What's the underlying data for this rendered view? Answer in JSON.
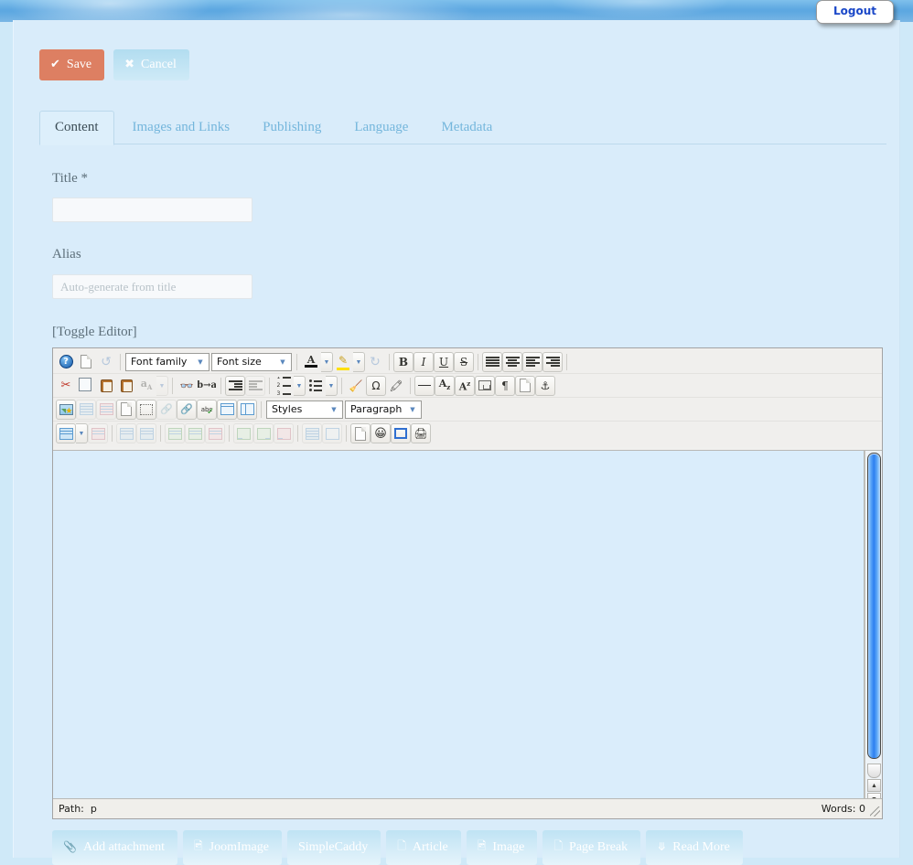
{
  "header": {
    "logout_label": "Logout"
  },
  "toolbar": {
    "save_label": "Save",
    "save_icon": "check-icon",
    "cancel_label": "Cancel",
    "cancel_icon": "close-circle-icon"
  },
  "tabs": [
    {
      "label": "Content",
      "active": true
    },
    {
      "label": "Images and Links",
      "active": false
    },
    {
      "label": "Publishing",
      "active": false
    },
    {
      "label": "Language",
      "active": false
    },
    {
      "label": "Metadata",
      "active": false
    }
  ],
  "form": {
    "title_label": "Title *",
    "title_value": "",
    "title_placeholder": "",
    "alias_label": "Alias",
    "alias_value": "",
    "alias_placeholder": "Auto-generate from title",
    "toggle_editor_label": "[Toggle Editor]"
  },
  "editor": {
    "selects": {
      "font_family": "Font family",
      "font_size": "Font size",
      "styles": "Styles",
      "paragraph": "Paragraph"
    },
    "status": {
      "path_label": "Path:",
      "path_value": "p",
      "words_label": "Words: 0"
    },
    "row1_icons": [
      "help-icon",
      "new-document-icon",
      "undo-icon",
      "text-color-icon",
      "background-color-icon",
      "redo-icon",
      "bold-icon",
      "italic-icon",
      "underline-icon",
      "strikethrough-icon",
      "align-justify-icon",
      "align-center-icon",
      "align-left-icon",
      "align-right-icon"
    ],
    "row2_icons": [
      "cut-icon",
      "copy-icon",
      "paste-icon",
      "paste-text-icon",
      "remove-format-icon",
      "find-icon",
      "find-replace-icon",
      "indent-icon",
      "outdent-icon",
      "numbered-list-icon",
      "bullet-list-icon",
      "cleanup-icon",
      "special-character-icon",
      "eraser-icon",
      "horizontal-rule-icon",
      "subscript-icon",
      "superscript-icon",
      "nonbreaking-space-icon",
      "pilcrow-icon",
      "page-properties-icon",
      "anchor-icon"
    ],
    "row3_icons": [
      "insert-image-icon",
      "insert-row-icon",
      "delete-row-icon",
      "template-icon",
      "visual-aid-icon",
      "unlink-icon",
      "link-icon",
      "spellcheck-icon",
      "horizontal-split-icon",
      "columns-icon"
    ],
    "row4_icons": [
      "insert-table-icon",
      "table-options-icon",
      "delete-table-icon",
      "row-properties-icon",
      "cell-properties-icon",
      "insert-row-before-icon",
      "insert-row-after-icon",
      "delete-row-icon",
      "insert-column-before-icon",
      "insert-column-after-icon",
      "delete-column-icon",
      "split-cells-icon",
      "merge-cells-icon",
      "media-icon",
      "emoticon-icon",
      "fullscreen-icon",
      "print-icon"
    ]
  },
  "bottom_buttons": [
    {
      "label": "Add attachment",
      "icon": "paperclip-icon"
    },
    {
      "label": "JoomImage",
      "icon": "picture-icon"
    },
    {
      "label": "SimpleCaddy",
      "icon": ""
    },
    {
      "label": "Article",
      "icon": "article-icon"
    },
    {
      "label": "Image",
      "icon": "picture-icon"
    },
    {
      "label": "Page Break",
      "icon": "pagebreak-icon"
    },
    {
      "label": "Read More",
      "icon": "chevron-down-icon"
    }
  ],
  "colors": {
    "page_background": "#d9ecfa",
    "banner": "#5fa9e2",
    "save_button": "#dd7f62",
    "tab_link": "#74b6dc",
    "editor_canvas": "#daedfb",
    "scrollbar_thumb": "#2d7ff0"
  }
}
